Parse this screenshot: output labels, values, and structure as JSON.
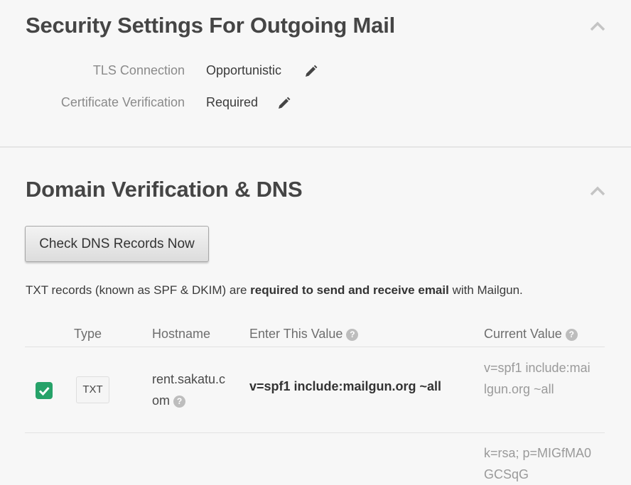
{
  "security": {
    "title": "Security Settings For Outgoing Mail",
    "rows": [
      {
        "label": "TLS Connection",
        "value": "Opportunistic"
      },
      {
        "label": "Certificate Verification",
        "value": "Required"
      }
    ]
  },
  "dns": {
    "title": "Domain Verification & DNS",
    "check_button": "Check DNS Records Now",
    "info_prefix": "TXT records (known as SPF & DKIM) are ",
    "info_bold": "required to send and receive email",
    "info_suffix": " with Mailgun.",
    "columns": {
      "type": "Type",
      "hostname": "Hostname",
      "enter_value": "Enter This Value",
      "current_value": "Current Value"
    },
    "records": [
      {
        "verified": true,
        "type": "TXT",
        "hostname": "rent.sakatu.com",
        "enter_value": "v=spf1 include:mailgun.org ~all",
        "current_value": "v=spf1 include:mailgun.org ~all"
      },
      {
        "current_value": "k=rsa; p=MIGfMA0GCSqG"
      }
    ]
  },
  "colors": {
    "check_green": "#26a269",
    "background": "#f7f7f7"
  },
  "icons": {
    "collapse": "chevron-up-icon",
    "edit": "pencil-icon",
    "help": "question-circle-icon",
    "verified": "checkmark-icon"
  }
}
